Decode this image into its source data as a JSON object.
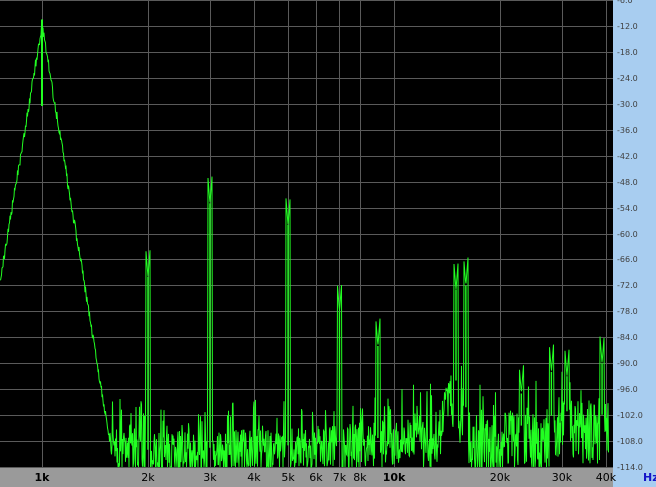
{
  "colors": {
    "background": "#000000",
    "grid": "#5a5a5a",
    "trace": "#22ff22",
    "y_axis_panel": "#a8cdf0",
    "x_axis_panel": "#9a9a9a",
    "unit_text": "#1515c8"
  },
  "chart_data": {
    "type": "line",
    "title": "",
    "xlabel": "",
    "ylabel": "",
    "x_unit": "Hz",
    "x_scale": "log",
    "xlim": [
      800,
      40000
    ],
    "ylim": [
      -114,
      -6
    ],
    "grid": true,
    "y_ticks": [
      -6,
      -12,
      -18,
      -24,
      -30,
      -36,
      -42,
      -48,
      -54,
      -60,
      -66,
      -72,
      -78,
      -84,
      -90,
      -96,
      -102,
      -108,
      -114
    ],
    "y_tick_labels": [
      "-6.0",
      "-12.0",
      "-18.0",
      "-24.0",
      "-30.0",
      "-36.0",
      "-42.0",
      "-48.0",
      "-54.0",
      "-60.0",
      "-66.0",
      "-72.0",
      "-78.0",
      "-84.0",
      "-90.0",
      "-96.0",
      "-102.0",
      "-108.0",
      "-114.0"
    ],
    "x_ticks": [
      1000,
      2000,
      3000,
      4000,
      5000,
      6000,
      7000,
      8000,
      10000,
      20000,
      30000,
      40000
    ],
    "x_tick_labels": [
      "1k",
      "2k",
      "3k",
      "4k",
      "5k",
      "6k",
      "7k",
      "8k",
      "10k",
      "20k",
      "30k",
      "40k"
    ],
    "x_major_ticks": [
      1000,
      10000
    ],
    "fundamental": {
      "frequency": 1000,
      "level": -10.5
    },
    "peaks": [
      {
        "frequency": 2000,
        "level": -70
      },
      {
        "frequency": 3000,
        "level": -53
      },
      {
        "frequency": 5000,
        "level": -58
      },
      {
        "frequency": 7000,
        "level": -78
      },
      {
        "frequency": 9000,
        "level": -86
      },
      {
        "frequency": 15000,
        "level": -73
      },
      {
        "frequency": 16000,
        "level": -72
      },
      {
        "frequency": 23000,
        "level": -97
      },
      {
        "frequency": 28000,
        "level": -92
      },
      {
        "frequency": 31000,
        "level": -93
      },
      {
        "frequency": 39000,
        "level": -90
      }
    ],
    "noise_floor": [
      {
        "frequency": 800,
        "level": -100
      },
      {
        "frequency": 1300,
        "level": -104
      },
      {
        "frequency": 2000,
        "level": -106
      },
      {
        "frequency": 5000,
        "level": -105
      },
      {
        "frequency": 10000,
        "level": -103
      },
      {
        "frequency": 13000,
        "level": -100
      },
      {
        "frequency": 15000,
        "level": -90
      },
      {
        "frequency": 17000,
        "level": -102
      },
      {
        "frequency": 25000,
        "level": -100
      },
      {
        "frequency": 30000,
        "level": -97
      },
      {
        "frequency": 40000,
        "level": -98
      }
    ]
  }
}
